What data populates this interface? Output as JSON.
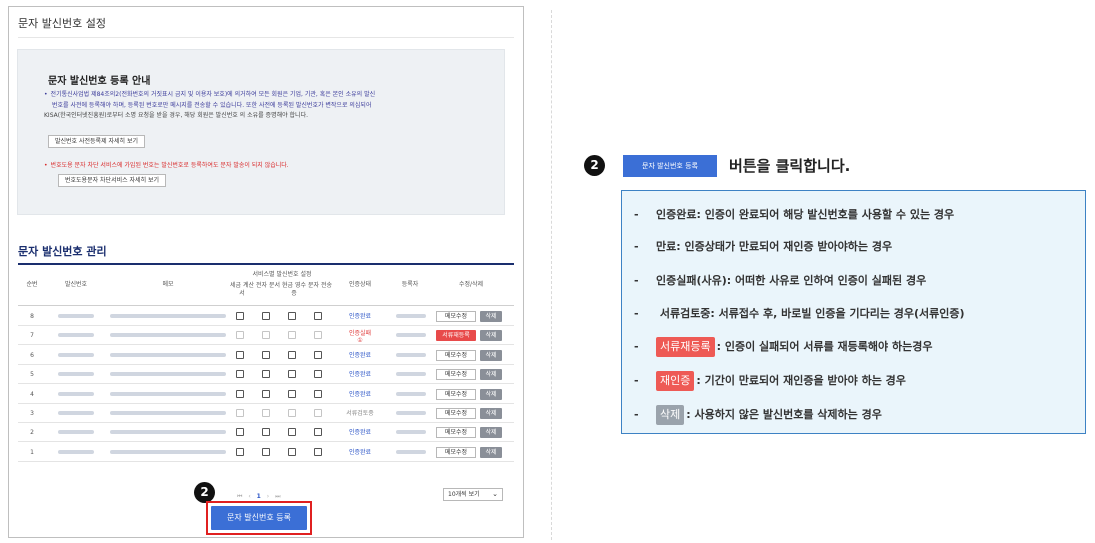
{
  "page_title": "문자 발신번호 설정",
  "guide": {
    "title": "문자 발신번호 등록 안내",
    "lines": [
      "전기통신사업법 제84조의2(전화번호의 거짓표시 금지 및 이용자 보호)에 의거하여 모든 회원은 기업, 기관, 혹은 본인 소유의 발신",
      "번호를 사전에 등록해야 하며, 등록된 번호로만 메시지를 전송할 수 있습니다. 또한 사전에 등록된 발신번호가 변작으로 의심되어",
      "KISA(한국인터넷진흥원)로부터 소명 요청을 받을 경우, 해당 회원은 발신번호 의 소유를 증명해야 합니다."
    ],
    "btn1": "발신번호 사전등록제 자세히 보기",
    "warn": "번호도용 문자 차단 서비스에 가입된 번호는 발신번호로 등록하여도 문자 발송이 되지 않습니다.",
    "btn2": "번호도용문자 차단서비스 자세히 보기"
  },
  "section_title": "문자 발신번호 관리",
  "table": {
    "headers": {
      "no": "순번",
      "number": "발신번호",
      "memo": "메모",
      "service_group": "서비스별 발신번호 설정",
      "svc1": "세금 계산서",
      "svc2": "전자 문서",
      "svc3": "현금 영수증",
      "svc4": "문자 전송",
      "status": "인증상태",
      "registrar": "등록자",
      "actions": "수정/삭제"
    },
    "rows": [
      {
        "no": "8",
        "status": "인증완료",
        "status_type": "ok",
        "action1": "메모수정",
        "action2": "삭제"
      },
      {
        "no": "7",
        "status": "인증실패",
        "status_sub": "①",
        "status_type": "fail",
        "action1": "서류재등록",
        "action2": "삭제"
      },
      {
        "no": "6",
        "status": "인증완료",
        "status_type": "ok",
        "action1": "메모수정",
        "action2": "삭제"
      },
      {
        "no": "5",
        "status": "인증완료",
        "status_type": "ok",
        "action1": "메모수정",
        "action2": "삭제"
      },
      {
        "no": "4",
        "status": "인증완료",
        "status_type": "ok",
        "action1": "메모수정",
        "action2": "삭제"
      },
      {
        "no": "3",
        "status": "서류검토중",
        "status_type": "doc",
        "action1": "메모수정",
        "action2": "삭제"
      },
      {
        "no": "2",
        "status": "인증완료",
        "status_type": "ok",
        "action1": "메모수정",
        "action2": "삭제"
      },
      {
        "no": "1",
        "status": "인증완료",
        "status_type": "ok",
        "action1": "메모수정",
        "action2": "삭제"
      }
    ]
  },
  "pager": {
    "first": "⏮",
    "prev": "‹",
    "current": "1",
    "next": "›",
    "last": "⏭"
  },
  "page_size": "10개씩 보기",
  "step_number": "2",
  "register_button": "문자 발신번호 등록",
  "legend": {
    "button": "문자 발신번호 등록",
    "headline": "버튼을 클릭합니다.",
    "items": [
      {
        "dash": "-",
        "text": "인증완료: 인증이 완료되어 해당 발신번호를 사용할 수 있는 경우"
      },
      {
        "dash": "-",
        "text": "만료: 인증상태가 만료되어 재인증 받아야하는 경우"
      },
      {
        "dash": "-",
        "text": "인증실패(사유): 어떠한 사유로 인하여 인증이 실패된 경우"
      },
      {
        "dash": "-",
        "text": " 서류검토중: 서류접수 후, 바로빌 인증을 기다리는 경우(서류인증)"
      },
      {
        "dash": "-",
        "tag": "서류재등록",
        "tag_color": "#ee5a55",
        "text": ": 인증이 실패되어 서류를 재등록해야 하는경우"
      },
      {
        "dash": "-",
        "tag": "재인증",
        "tag_color": "#ee5a55",
        "text": ": 기간이 만료되어 재인증을 받아야 하는 경우"
      },
      {
        "dash": "-",
        "tag": "삭제",
        "tag_color": "#9aa3ac",
        "text": ": 사용하지 않은 발신번호를 삭제하는 경우"
      }
    ]
  },
  "colors": {
    "accent": "#3b6fd6",
    "title_navy": "#1a2e6e",
    "warn_red": "#d92a2a",
    "highlight_red": "#e02020"
  }
}
